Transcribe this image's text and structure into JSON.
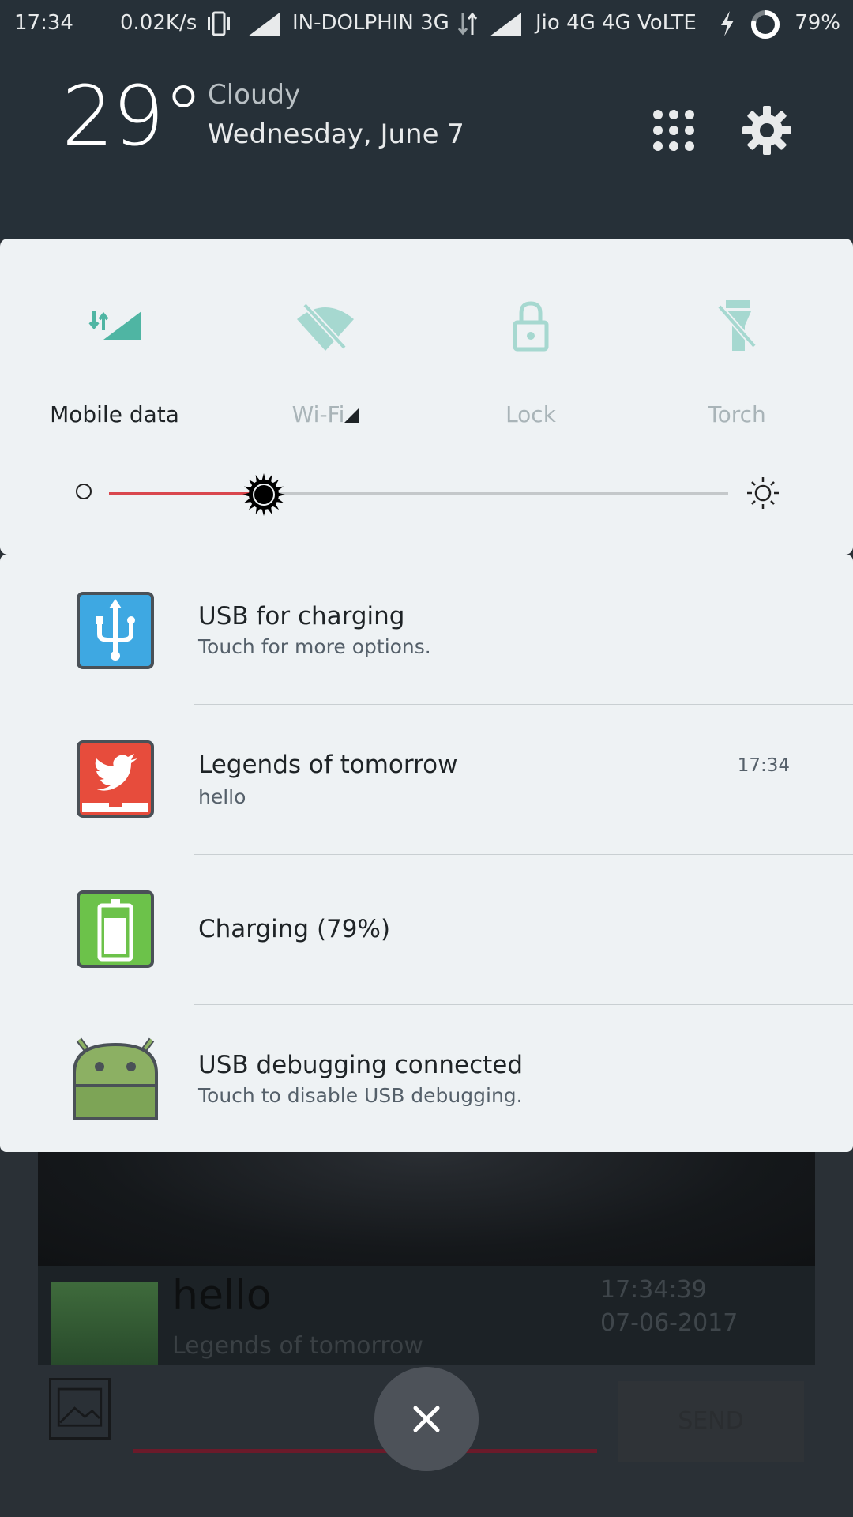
{
  "status_bar": {
    "time": "17:34",
    "net_speed": "0.02K/s",
    "carrier1": "IN-DOLPHIN 3G",
    "carrier2": "Jio 4G  4G  VoLTE",
    "battery": "79%"
  },
  "header": {
    "temperature": "29°",
    "weather": "Cloudy",
    "date": "Wednesday, June 7"
  },
  "quick_settings": {
    "tiles": [
      {
        "label": "Mobile data",
        "icon": "mobile-data-icon",
        "active": true
      },
      {
        "label": "Wi-Fi",
        "icon": "wifi-off-icon",
        "active": false
      },
      {
        "label": "Lock",
        "icon": "lock-icon",
        "active": false
      },
      {
        "label": "Torch",
        "icon": "torch-off-icon",
        "active": false
      }
    ],
    "brightness_level": 0.25
  },
  "notifications": [
    {
      "title": "USB for charging",
      "subtitle": "Touch for more options.",
      "time": "",
      "icon": "usb-icon",
      "color": "#3ea8e2"
    },
    {
      "title": "Legends of tomorrow",
      "subtitle": "hello",
      "time": "17:34",
      "icon": "twitter-bird-icon",
      "color": "#e74c3c"
    },
    {
      "title": "Charging (79%)",
      "subtitle": "",
      "time": "",
      "icon": "battery-charging-icon",
      "color": "#6cc24a"
    },
    {
      "title": "USB debugging connected",
      "subtitle": "Touch to disable USB debugging.",
      "time": "",
      "icon": "android-icon",
      "color": "#8cb063"
    }
  ],
  "background_app": {
    "message": "hello",
    "sender": "Legends of tomorrow",
    "stamp_time": "17:34:39",
    "stamp_date": "07-06-2017",
    "send_label": "SEND"
  },
  "colors": {
    "accent": "#d9474e",
    "teal": "#4fb5a3",
    "panel": "#eef2f4",
    "header": "#263038"
  }
}
